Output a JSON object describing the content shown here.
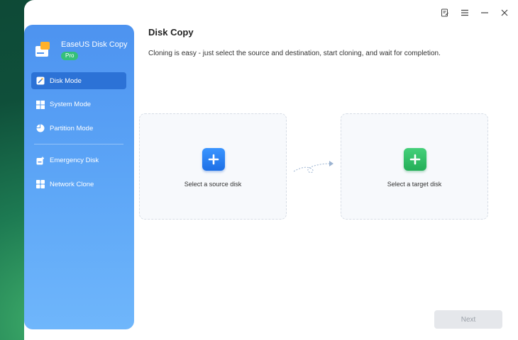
{
  "app": {
    "name": "EaseUS Disk Copy",
    "edition_badge": "Pro"
  },
  "titlebar": {
    "icons": [
      "notes-icon",
      "menu-icon",
      "minimize-icon",
      "close-icon"
    ]
  },
  "sidebar": {
    "items": [
      {
        "label": "Disk Mode",
        "icon": "disk-mode-icon",
        "active": true
      },
      {
        "label": "System Mode",
        "icon": "windows-icon",
        "active": false
      },
      {
        "label": "Partition Mode",
        "icon": "pie-chart-icon",
        "active": false
      },
      {
        "label": "Emergency Disk",
        "icon": "emergency-disk-icon",
        "active": false
      },
      {
        "label": "Network Clone",
        "icon": "network-clone-icon",
        "active": false
      }
    ]
  },
  "main": {
    "title": "Disk Copy",
    "subtitle": "Cloning is easy - just select the source and destination, start cloning, and wait for completion.",
    "source_card": {
      "label": "Select a source disk"
    },
    "target_card": {
      "label": "Select a target disk"
    },
    "next_button": {
      "label": "Next",
      "enabled": false
    }
  },
  "colors": {
    "sidebar_top": "#4d93f0",
    "sidebar_active": "#2c72d6",
    "source_plus": "#1d6fe6",
    "target_plus": "#23ae57",
    "badge": "#35c07a"
  }
}
